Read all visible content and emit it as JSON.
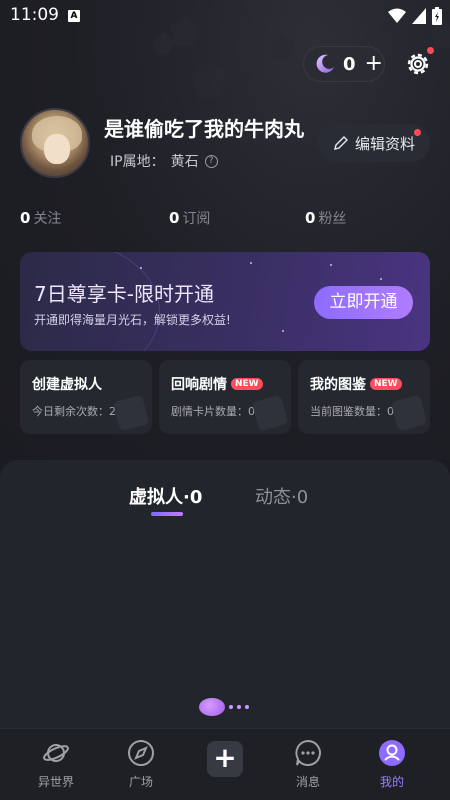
{
  "status_bar": {
    "time": "11:09",
    "notif_icon_letter": "A"
  },
  "header": {
    "moon_count": "0",
    "add_symbol": "+"
  },
  "profile": {
    "username": "是谁偷吃了我的牛肉丸",
    "ip_label": "IP属地：",
    "ip_location": "黄石",
    "help_symbol": "?",
    "edit_label": "编辑资料"
  },
  "stats": [
    {
      "num": "0",
      "label": "关注"
    },
    {
      "num": "0",
      "label": "订阅"
    },
    {
      "num": "0",
      "label": "粉丝"
    }
  ],
  "vip": {
    "title": "7日尊享卡-限时开通",
    "subtitle": "开通即得海量月光石，解锁更多权益!",
    "button": "立即开通"
  },
  "cards": [
    {
      "title": "创建虚拟人",
      "badge": "",
      "sub": "今日剩余次数：2"
    },
    {
      "title": "回响剧情",
      "badge": "NEW",
      "sub": "剧情卡片数量：0"
    },
    {
      "title": "我的图鉴",
      "badge": "NEW",
      "sub": "当前图鉴数量：0"
    }
  ],
  "tabs": {
    "active": "虚拟人·0",
    "inactive": "动态·0"
  },
  "nav": [
    {
      "label": "异世界",
      "icon": "planet-icon"
    },
    {
      "label": "广场",
      "icon": "compass-icon"
    },
    {
      "label": "",
      "icon": "plus-icon"
    },
    {
      "label": "消息",
      "icon": "chat-icon"
    },
    {
      "label": "我的",
      "icon": "profile-icon"
    }
  ],
  "nav_center_symbol": "+",
  "colors": {
    "accent": "#9b7cff",
    "badge": "#ff4d5e",
    "background": "#1b1c22"
  }
}
